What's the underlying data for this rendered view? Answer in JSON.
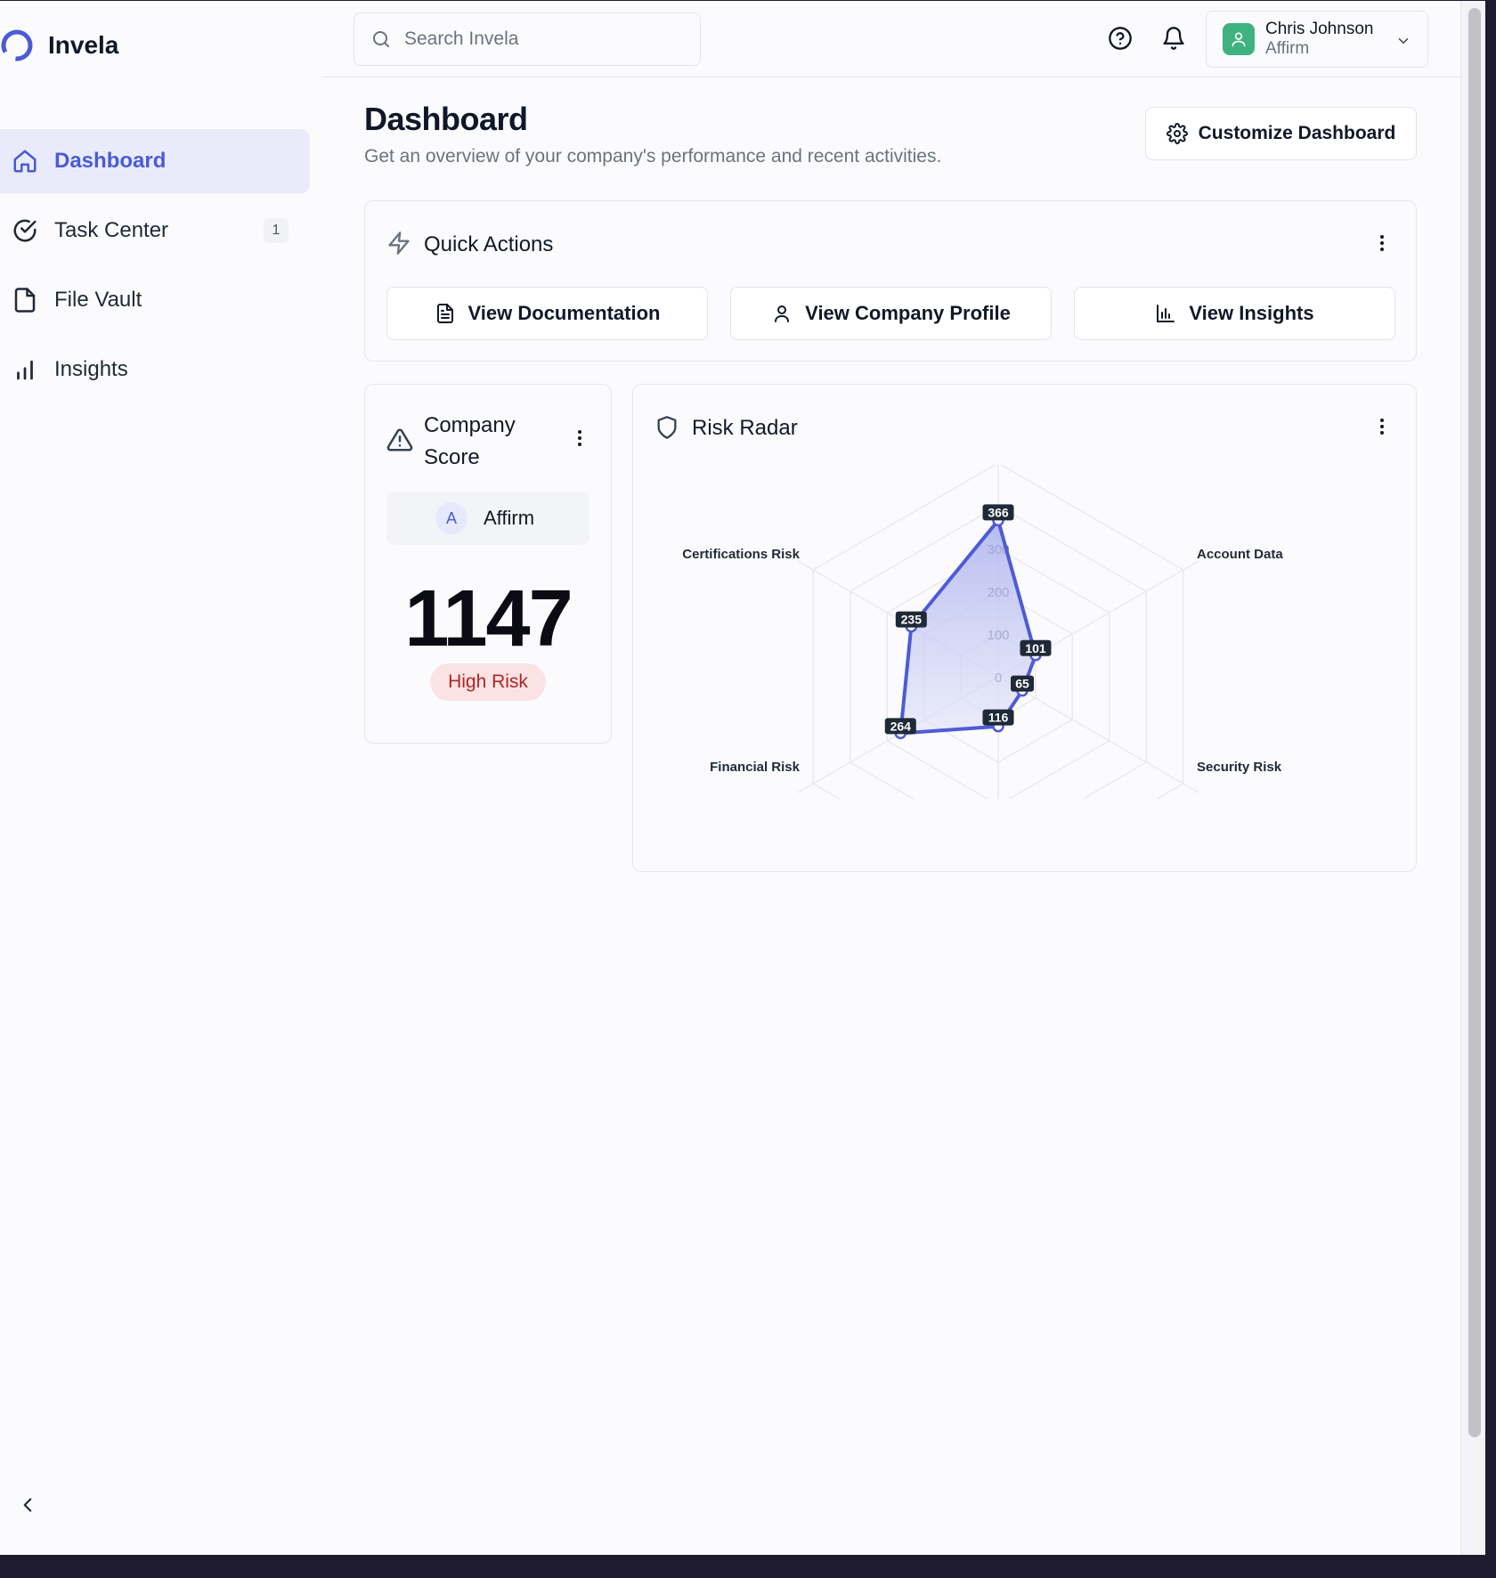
{
  "app": {
    "name": "Invela"
  },
  "sidebar": {
    "items": [
      {
        "label": "Dashboard",
        "icon": "home-icon",
        "active": true
      },
      {
        "label": "Task Center",
        "icon": "check-circle-icon",
        "badge": "1"
      },
      {
        "label": "File Vault",
        "icon": "file-icon"
      },
      {
        "label": "Insights",
        "icon": "bar-chart-icon"
      }
    ]
  },
  "header": {
    "search_placeholder": "Search Invela",
    "user": {
      "name": "Chris Johnson",
      "company": "Affirm"
    }
  },
  "page": {
    "title": "Dashboard",
    "subtitle": "Get an overview of your company's performance and recent activities.",
    "customize_label": "Customize Dashboard"
  },
  "quick_actions": {
    "title": "Quick Actions",
    "buttons": [
      {
        "label": "View Documentation",
        "icon": "document-icon"
      },
      {
        "label": "View Company Profile",
        "icon": "user-icon"
      },
      {
        "label": "View Insights",
        "icon": "bar-chart-icon"
      }
    ]
  },
  "company_score": {
    "title_line1": "Company",
    "title_line2": "Score",
    "company_initial": "A",
    "company_name": "Affirm",
    "score": "1147",
    "risk_level": "High Risk"
  },
  "risk_radar": {
    "title": "Risk Radar"
  },
  "chart_data": {
    "type": "radar",
    "categories": [
      "Account Data",
      "Security Risk",
      "Financial Risk",
      "Certifications Risk"
    ],
    "axis_ticks": [
      "0",
      "100",
      "200",
      "300"
    ],
    "points": [
      {
        "label": "366",
        "value": 366
      },
      {
        "label": "101",
        "value": 101
      },
      {
        "label": "65",
        "value": 65
      },
      {
        "label": "116",
        "value": 116
      },
      {
        "label": "264",
        "value": 264
      },
      {
        "label": "235",
        "value": 235
      }
    ],
    "colors": {
      "series": "#4f5bd5",
      "fill": "#c7cbf2",
      "grid": "#e5e7eb"
    }
  }
}
